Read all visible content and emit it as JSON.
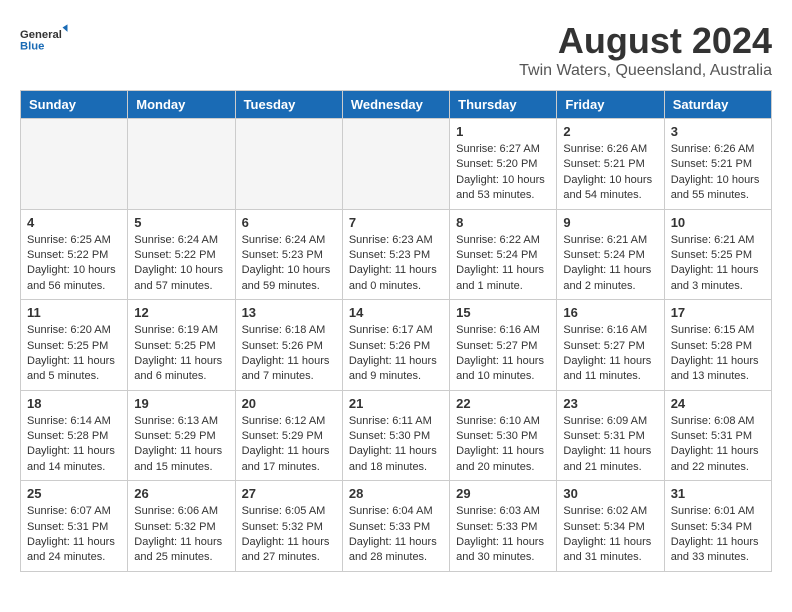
{
  "header": {
    "logo_general": "General",
    "logo_blue": "Blue",
    "month_year": "August 2024",
    "location": "Twin Waters, Queensland, Australia"
  },
  "days_of_week": [
    "Sunday",
    "Monday",
    "Tuesday",
    "Wednesday",
    "Thursday",
    "Friday",
    "Saturday"
  ],
  "weeks": [
    [
      {
        "day": "",
        "empty": true
      },
      {
        "day": "",
        "empty": true
      },
      {
        "day": "",
        "empty": true
      },
      {
        "day": "",
        "empty": true
      },
      {
        "day": "1",
        "sunrise": "Sunrise: 6:27 AM",
        "sunset": "Sunset: 5:20 PM",
        "daylight": "Daylight: 10 hours and 53 minutes."
      },
      {
        "day": "2",
        "sunrise": "Sunrise: 6:26 AM",
        "sunset": "Sunset: 5:21 PM",
        "daylight": "Daylight: 10 hours and 54 minutes."
      },
      {
        "day": "3",
        "sunrise": "Sunrise: 6:26 AM",
        "sunset": "Sunset: 5:21 PM",
        "daylight": "Daylight: 10 hours and 55 minutes."
      }
    ],
    [
      {
        "day": "4",
        "sunrise": "Sunrise: 6:25 AM",
        "sunset": "Sunset: 5:22 PM",
        "daylight": "Daylight: 10 hours and 56 minutes."
      },
      {
        "day": "5",
        "sunrise": "Sunrise: 6:24 AM",
        "sunset": "Sunset: 5:22 PM",
        "daylight": "Daylight: 10 hours and 57 minutes."
      },
      {
        "day": "6",
        "sunrise": "Sunrise: 6:24 AM",
        "sunset": "Sunset: 5:23 PM",
        "daylight": "Daylight: 10 hours and 59 minutes."
      },
      {
        "day": "7",
        "sunrise": "Sunrise: 6:23 AM",
        "sunset": "Sunset: 5:23 PM",
        "daylight": "Daylight: 11 hours and 0 minutes."
      },
      {
        "day": "8",
        "sunrise": "Sunrise: 6:22 AM",
        "sunset": "Sunset: 5:24 PM",
        "daylight": "Daylight: 11 hours and 1 minute."
      },
      {
        "day": "9",
        "sunrise": "Sunrise: 6:21 AM",
        "sunset": "Sunset: 5:24 PM",
        "daylight": "Daylight: 11 hours and 2 minutes."
      },
      {
        "day": "10",
        "sunrise": "Sunrise: 6:21 AM",
        "sunset": "Sunset: 5:25 PM",
        "daylight": "Daylight: 11 hours and 3 minutes."
      }
    ],
    [
      {
        "day": "11",
        "sunrise": "Sunrise: 6:20 AM",
        "sunset": "Sunset: 5:25 PM",
        "daylight": "Daylight: 11 hours and 5 minutes."
      },
      {
        "day": "12",
        "sunrise": "Sunrise: 6:19 AM",
        "sunset": "Sunset: 5:25 PM",
        "daylight": "Daylight: 11 hours and 6 minutes."
      },
      {
        "day": "13",
        "sunrise": "Sunrise: 6:18 AM",
        "sunset": "Sunset: 5:26 PM",
        "daylight": "Daylight: 11 hours and 7 minutes."
      },
      {
        "day": "14",
        "sunrise": "Sunrise: 6:17 AM",
        "sunset": "Sunset: 5:26 PM",
        "daylight": "Daylight: 11 hours and 9 minutes."
      },
      {
        "day": "15",
        "sunrise": "Sunrise: 6:16 AM",
        "sunset": "Sunset: 5:27 PM",
        "daylight": "Daylight: 11 hours and 10 minutes."
      },
      {
        "day": "16",
        "sunrise": "Sunrise: 6:16 AM",
        "sunset": "Sunset: 5:27 PM",
        "daylight": "Daylight: 11 hours and 11 minutes."
      },
      {
        "day": "17",
        "sunrise": "Sunrise: 6:15 AM",
        "sunset": "Sunset: 5:28 PM",
        "daylight": "Daylight: 11 hours and 13 minutes."
      }
    ],
    [
      {
        "day": "18",
        "sunrise": "Sunrise: 6:14 AM",
        "sunset": "Sunset: 5:28 PM",
        "daylight": "Daylight: 11 hours and 14 minutes."
      },
      {
        "day": "19",
        "sunrise": "Sunrise: 6:13 AM",
        "sunset": "Sunset: 5:29 PM",
        "daylight": "Daylight: 11 hours and 15 minutes."
      },
      {
        "day": "20",
        "sunrise": "Sunrise: 6:12 AM",
        "sunset": "Sunset: 5:29 PM",
        "daylight": "Daylight: 11 hours and 17 minutes."
      },
      {
        "day": "21",
        "sunrise": "Sunrise: 6:11 AM",
        "sunset": "Sunset: 5:30 PM",
        "daylight": "Daylight: 11 hours and 18 minutes."
      },
      {
        "day": "22",
        "sunrise": "Sunrise: 6:10 AM",
        "sunset": "Sunset: 5:30 PM",
        "daylight": "Daylight: 11 hours and 20 minutes."
      },
      {
        "day": "23",
        "sunrise": "Sunrise: 6:09 AM",
        "sunset": "Sunset: 5:31 PM",
        "daylight": "Daylight: 11 hours and 21 minutes."
      },
      {
        "day": "24",
        "sunrise": "Sunrise: 6:08 AM",
        "sunset": "Sunset: 5:31 PM",
        "daylight": "Daylight: 11 hours and 22 minutes."
      }
    ],
    [
      {
        "day": "25",
        "sunrise": "Sunrise: 6:07 AM",
        "sunset": "Sunset: 5:31 PM",
        "daylight": "Daylight: 11 hours and 24 minutes."
      },
      {
        "day": "26",
        "sunrise": "Sunrise: 6:06 AM",
        "sunset": "Sunset: 5:32 PM",
        "daylight": "Daylight: 11 hours and 25 minutes."
      },
      {
        "day": "27",
        "sunrise": "Sunrise: 6:05 AM",
        "sunset": "Sunset: 5:32 PM",
        "daylight": "Daylight: 11 hours and 27 minutes."
      },
      {
        "day": "28",
        "sunrise": "Sunrise: 6:04 AM",
        "sunset": "Sunset: 5:33 PM",
        "daylight": "Daylight: 11 hours and 28 minutes."
      },
      {
        "day": "29",
        "sunrise": "Sunrise: 6:03 AM",
        "sunset": "Sunset: 5:33 PM",
        "daylight": "Daylight: 11 hours and 30 minutes."
      },
      {
        "day": "30",
        "sunrise": "Sunrise: 6:02 AM",
        "sunset": "Sunset: 5:34 PM",
        "daylight": "Daylight: 11 hours and 31 minutes."
      },
      {
        "day": "31",
        "sunrise": "Sunrise: 6:01 AM",
        "sunset": "Sunset: 5:34 PM",
        "daylight": "Daylight: 11 hours and 33 minutes."
      }
    ]
  ]
}
